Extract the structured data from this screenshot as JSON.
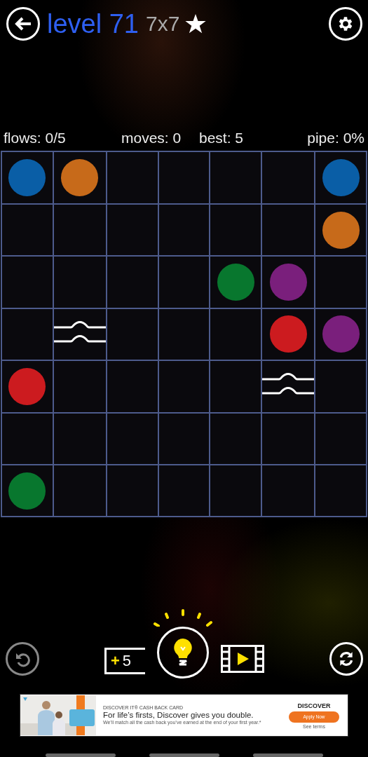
{
  "header": {
    "title": "level 71",
    "size": "7x7"
  },
  "stats": {
    "flows": "flows: 0/5",
    "moves": "moves: 0",
    "best": "best: 5",
    "pipe": "pipe: 0%"
  },
  "board": {
    "rows": [
      [
        {
          "kind": "dot",
          "color": "#0a5ea6"
        },
        {
          "kind": "dot",
          "color": "#c76a1a"
        },
        {
          "kind": "empty"
        },
        {
          "kind": "empty"
        },
        {
          "kind": "empty"
        },
        {
          "kind": "empty"
        },
        {
          "kind": "dot",
          "color": "#0a5ea6"
        }
      ],
      [
        {
          "kind": "empty"
        },
        {
          "kind": "empty"
        },
        {
          "kind": "empty"
        },
        {
          "kind": "empty"
        },
        {
          "kind": "empty"
        },
        {
          "kind": "empty"
        },
        {
          "kind": "dot",
          "color": "#c76a1a"
        }
      ],
      [
        {
          "kind": "empty"
        },
        {
          "kind": "empty"
        },
        {
          "kind": "empty"
        },
        {
          "kind": "empty"
        },
        {
          "kind": "dot",
          "color": "#08772e"
        },
        {
          "kind": "dot",
          "color": "#7a1f7c"
        },
        {
          "kind": "empty"
        }
      ],
      [
        {
          "kind": "empty"
        },
        {
          "kind": "bridge"
        },
        {
          "kind": "empty"
        },
        {
          "kind": "empty"
        },
        {
          "kind": "empty"
        },
        {
          "kind": "dot",
          "color": "#cc1b1f"
        },
        {
          "kind": "dot",
          "color": "#7a1f7c"
        }
      ],
      [
        {
          "kind": "dot",
          "color": "#cc1b1f"
        },
        {
          "kind": "empty"
        },
        {
          "kind": "empty"
        },
        {
          "kind": "empty"
        },
        {
          "kind": "empty"
        },
        {
          "kind": "bridge"
        },
        {
          "kind": "empty"
        }
      ],
      [
        {
          "kind": "empty"
        },
        {
          "kind": "empty"
        },
        {
          "kind": "empty"
        },
        {
          "kind": "empty"
        },
        {
          "kind": "empty"
        },
        {
          "kind": "empty"
        },
        {
          "kind": "empty"
        }
      ],
      [
        {
          "kind": "dot",
          "color": "#08772e"
        },
        {
          "kind": "empty"
        },
        {
          "kind": "empty"
        },
        {
          "kind": "empty"
        },
        {
          "kind": "empty"
        },
        {
          "kind": "empty"
        },
        {
          "kind": "empty"
        }
      ]
    ]
  },
  "hints": {
    "plus": "+",
    "count": "5"
  },
  "ad": {
    "kicker": "DISCOVER IT® CASH BACK CARD",
    "headline": "For life’s firsts, Discover gives you double.",
    "body": "We’ll match all the cash back you’ve earned at the end of your first year.*",
    "brand": "DISCOVER",
    "button": "Apply Now",
    "link": "See terms"
  }
}
